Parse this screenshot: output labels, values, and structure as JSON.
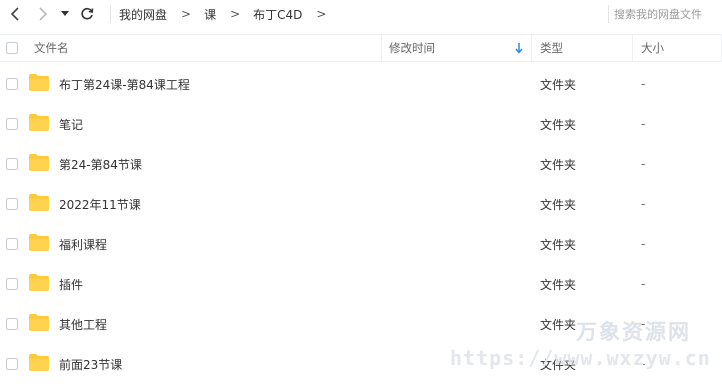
{
  "toolbar": {
    "breadcrumbs": [
      "我的网盘",
      "课",
      "布丁C4D"
    ],
    "separator": ">",
    "search_placeholder": "搜索我的网盘文件"
  },
  "table": {
    "columns": {
      "name": "文件名",
      "modified": "修改时间",
      "type": "类型",
      "size": "大小"
    },
    "rows": [
      {
        "name": "布丁第24课-第84课工程",
        "type": "文件夹",
        "size": "-"
      },
      {
        "name": "笔记",
        "type": "文件夹",
        "size": "-"
      },
      {
        "name": "第24-第84节课",
        "type": "文件夹",
        "size": "-"
      },
      {
        "name": "2022年11节课",
        "type": "文件夹",
        "size": "-"
      },
      {
        "name": "福利课程",
        "type": "文件夹",
        "size": "-"
      },
      {
        "name": "插件",
        "type": "文件夹",
        "size": "-"
      },
      {
        "name": "其他工程",
        "type": "文件夹",
        "size": "-"
      },
      {
        "name": "前面23节课",
        "type": "文件夹",
        "size": "-"
      }
    ]
  },
  "watermark": {
    "title": "万象资源网",
    "url": "https://www.wxzyw.cn"
  },
  "colors": {
    "folder": "#ffc83d",
    "sort_arrow": "#2e8ae6"
  }
}
